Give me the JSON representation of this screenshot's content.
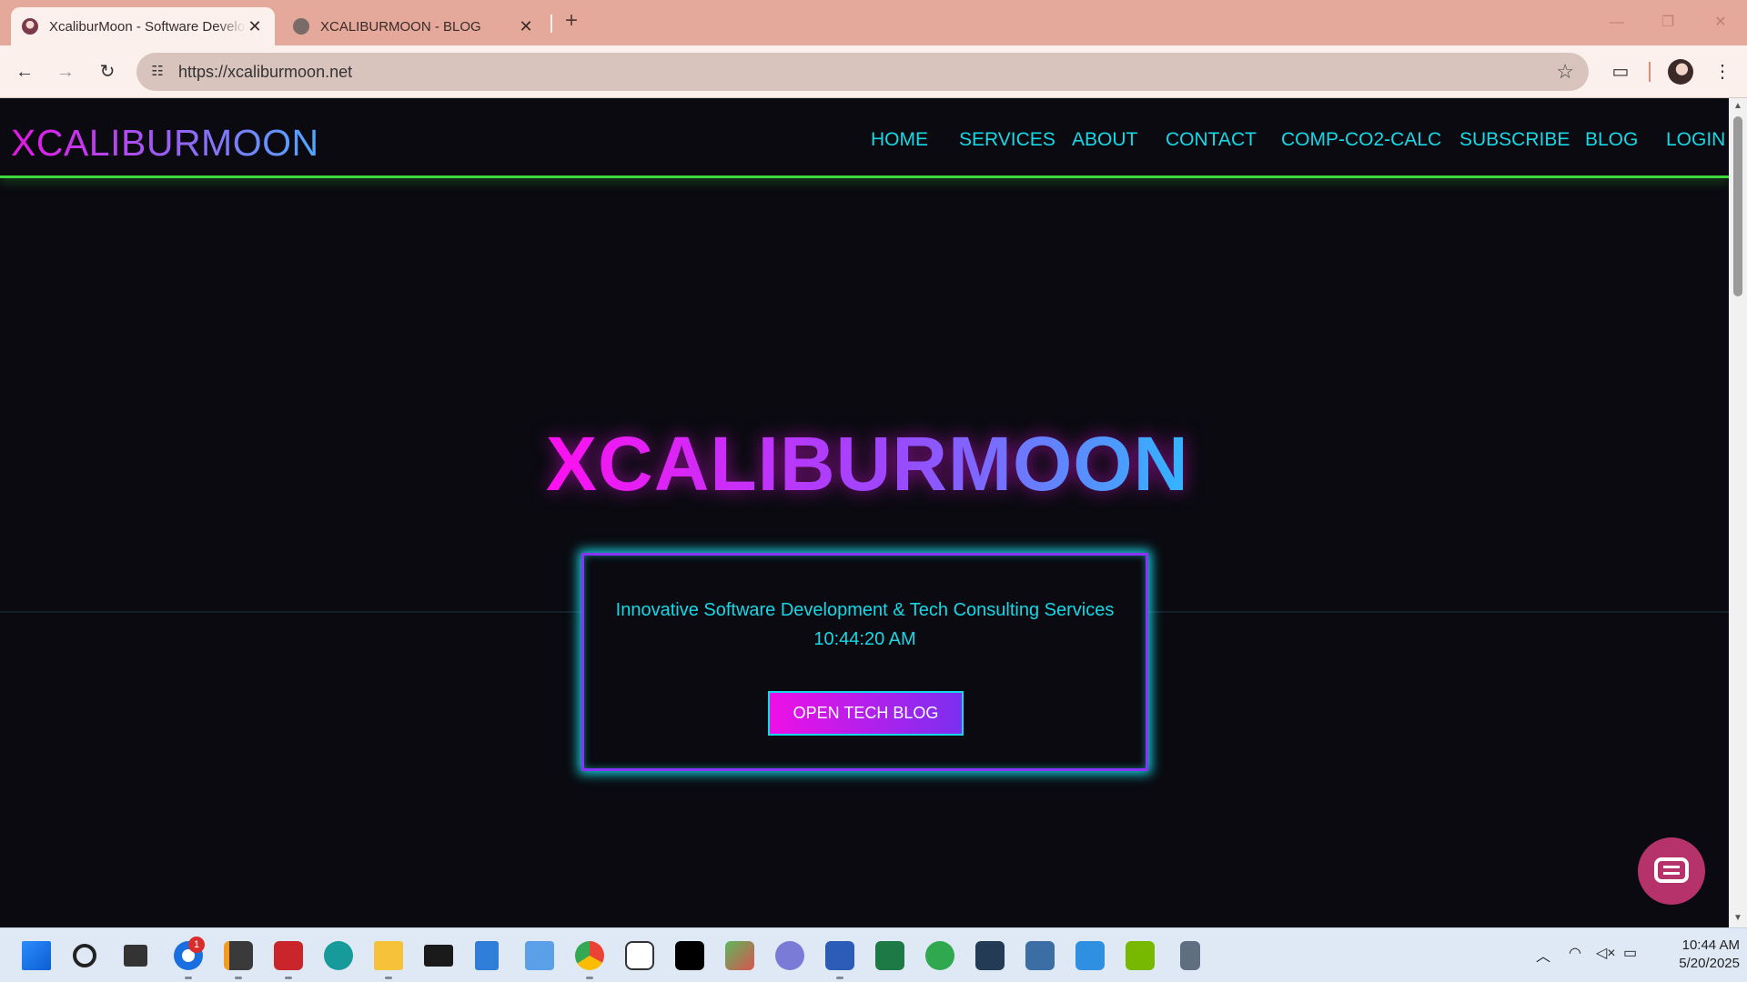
{
  "browser": {
    "tabs": [
      {
        "title": "XcaliburMoon - Software Development",
        "active": true
      },
      {
        "title": "XCALIBURMOON - BLOG",
        "active": false
      }
    ],
    "url": "https://xcaliburmoon.net",
    "new_tab_symbol": "+",
    "close_symbol": "✕"
  },
  "site": {
    "logo": "XCALIBURMOON",
    "nav": [
      "HOME",
      "SERVICES",
      "ABOUT",
      "CONTACT",
      "COMP-CO2-CALC",
      "SUBSCRIBE",
      "BLOG",
      "LOGIN"
    ],
    "hero_title": "XCALIBURMOON",
    "tagline": "Innovative Software Development & Tech Consulting Services",
    "clock": "10:44:20 AM",
    "cta_label": "OPEN TECH BLOG"
  },
  "colors": {
    "accent_cyan": "#16d8e6",
    "accent_magenta": "#ee10e6",
    "accent_purple": "#7b2ff0",
    "header_line": "#3fd93f",
    "page_bg": "#0a0a10"
  },
  "taskbar": {
    "apps": [
      "windows-start-icon",
      "search-icon",
      "task-view-icon",
      "thunderbird-icon",
      "sublime-text-icon",
      "filezilla-icon",
      "arduino-icon",
      "file-explorer-icon",
      "terminal-icon",
      "notepad-icon",
      "snipping-tool-icon",
      "chrome-icon",
      "copilot-icon",
      "unity-icon",
      "paint-icon",
      "teams-icon",
      "word-icon",
      "excel-icon",
      "network-icon",
      "mysql-workbench-icon",
      "remote-desktop-icon",
      "r-studio-icon",
      "nvidia-icon",
      "calculator-icon"
    ],
    "mail_badge": "1",
    "time": "10:44 AM",
    "date": "5/20/2025"
  }
}
